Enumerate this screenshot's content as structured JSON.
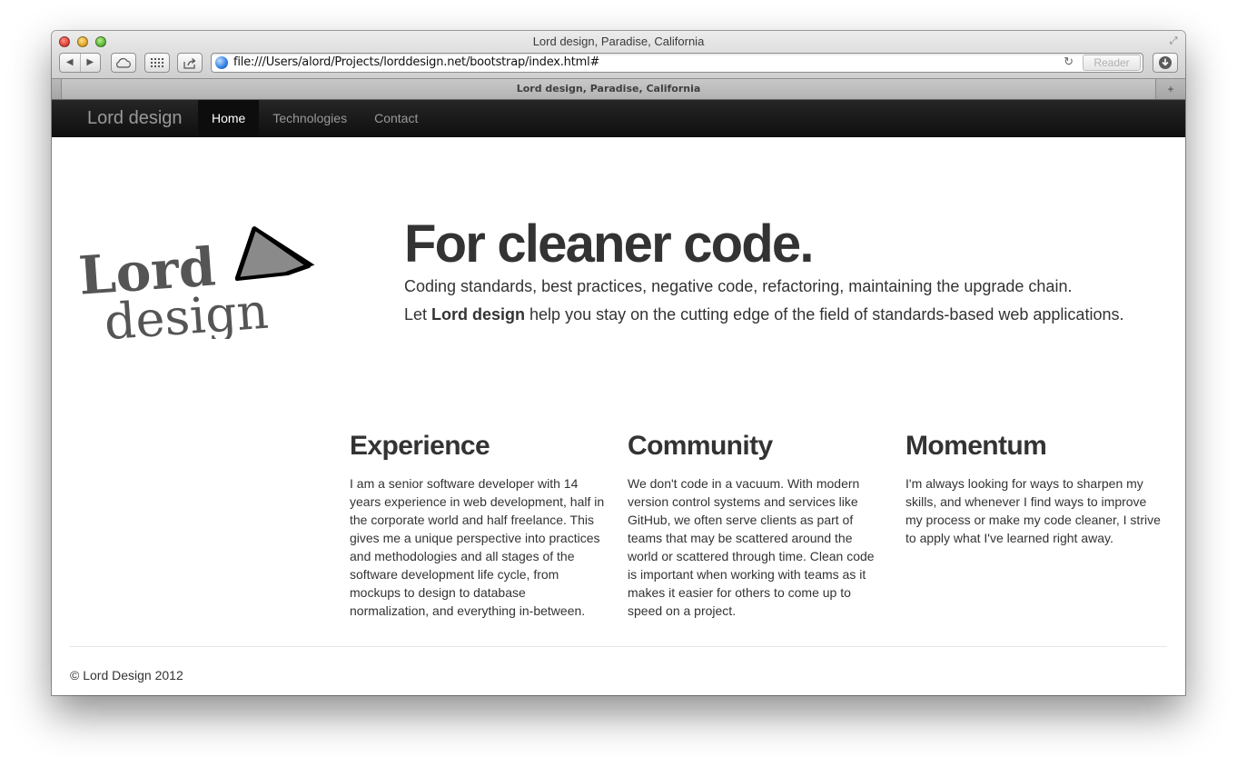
{
  "browser": {
    "window_title": "Lord design, Paradise, California",
    "url": "file:///Users/alord/Projects/lorddesign.net/bootstrap/index.html#",
    "reader_label": "Reader",
    "tab_title": "Lord design, Paradise, California",
    "new_tab_glyph": "+",
    "reload_glyph": "↻",
    "back_glyph": "◀",
    "forward_glyph": "▶"
  },
  "navbar": {
    "brand": "Lord design",
    "items": [
      {
        "label": "Home",
        "active": true
      },
      {
        "label": "Technologies",
        "active": false
      },
      {
        "label": "Contact",
        "active": false
      }
    ]
  },
  "logo": {
    "word1": "Lord",
    "word2": "design"
  },
  "hero": {
    "title": "For cleaner code.",
    "line1": "Coding standards, best practices, negative code, refactoring, maintaining the upgrade chain.",
    "line2_prefix": "Let ",
    "line2_bold": "Lord design",
    "line2_suffix": " help you stay on the cutting edge of the field of standards-based web applications."
  },
  "columns": [
    {
      "heading": "Experience",
      "body": "I am a senior software developer with 14 years experience in web development, half in the corporate world and half freelance. This gives me a unique perspective into practices and methodologies and all stages of the software development life cycle, from mockups to design to database normalization, and everything in-between."
    },
    {
      "heading": "Community",
      "body": "We don't code in a vacuum. With modern version control systems and services like GitHub, we often serve clients as part of teams that may be scattered around the world or scattered through time. Clean code is important when working with teams as it makes it easier for others to come up to speed on a project."
    },
    {
      "heading": "Momentum",
      "body": "I'm always looking for ways to sharpen my skills, and whenever I find ways to improve my process or make my code cleaner, I strive to apply what I've learned right away."
    }
  ],
  "footer": {
    "text": "© Lord Design 2012"
  }
}
